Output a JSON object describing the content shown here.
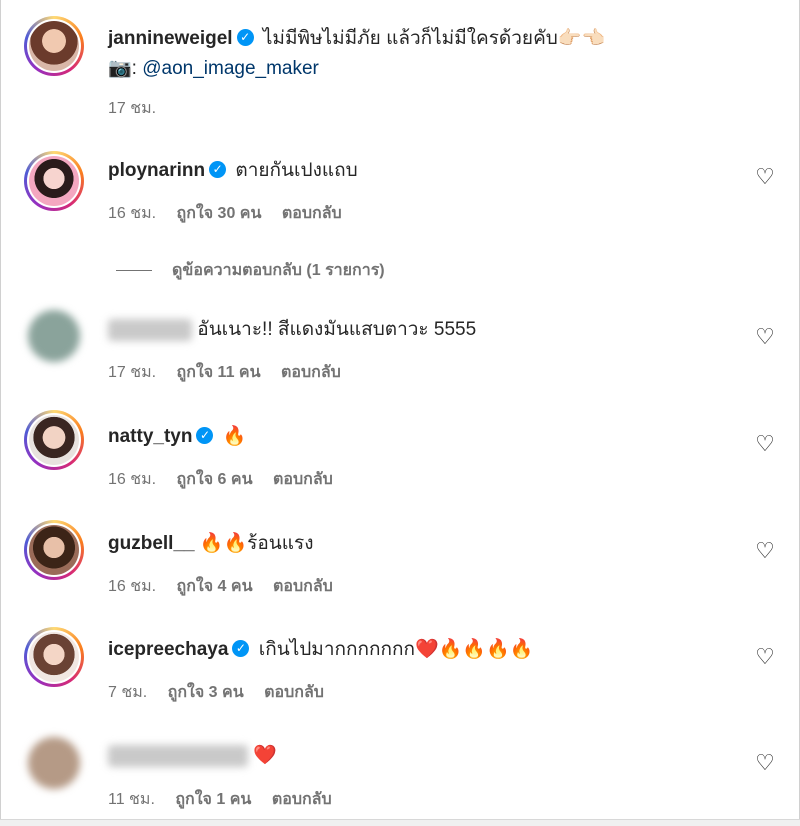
{
  "post": {
    "username": "jannineweigel",
    "caption": "ไม่มีพิษไม่มีภัย แล้วก็ไม่มีใครด้วยคับ👉🏻👈🏻",
    "camera_glyph": "📷:",
    "mention": "@aon_image_maker",
    "time": "17 ชม."
  },
  "labels": {
    "reply": "ตอบกลับ",
    "view_replies": "ดูข้อความตอบกลับ (1 รายการ)"
  },
  "comments": [
    {
      "username": "ploynarinn",
      "verified": true,
      "text": "ตายกันเปงแถบ",
      "time": "16 ชม.",
      "likes": "ถูกใจ 30 คน"
    },
    {
      "username": "",
      "verified": false,
      "text": "อันเนาะ!! สีแดงมันแสบตาวะ 5555",
      "time": "17 ชม.",
      "likes": "ถูกใจ 11 คน"
    },
    {
      "username": "natty_tyn",
      "verified": true,
      "text": "🔥",
      "time": "16 ชม.",
      "likes": "ถูกใจ 6 คน"
    },
    {
      "username": "guzbell__",
      "verified": false,
      "text": "🔥🔥ร้อนแรง",
      "time": "16 ชม.",
      "likes": "ถูกใจ 4 คน"
    },
    {
      "username": "icepreechaya",
      "verified": true,
      "text": "เกินไปมากกกกกกก❤️🔥🔥🔥🔥",
      "time": "7 ชม.",
      "likes": "ถูกใจ 3 คน"
    },
    {
      "username": "",
      "verified": false,
      "text": "❤️",
      "time": "11 ชม.",
      "likes": "ถูกใจ 1 คน"
    }
  ],
  "icons": {
    "heart": "heart-outline-icon",
    "verified": "verified-badge-icon"
  },
  "colors": {
    "accent": "#0095f6",
    "mention": "#00376b",
    "meta": "#737373"
  }
}
